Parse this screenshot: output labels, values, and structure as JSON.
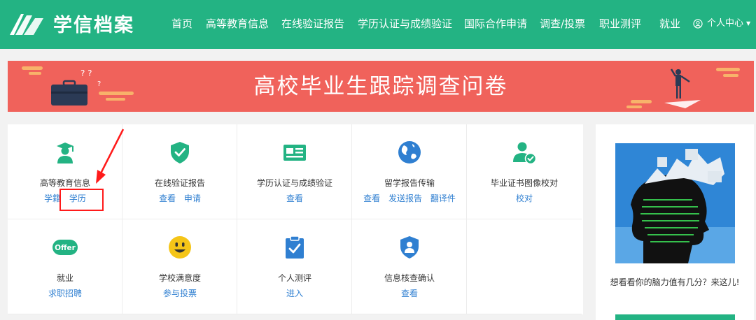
{
  "header": {
    "brand": "学信档案",
    "nav": [
      "首页",
      "高等教育信息",
      "在线验证报告",
      "学历认证与成绩验证",
      "国际合作申请",
      "调查/投票",
      "职业测评",
      "就业"
    ],
    "user_menu": "个人中心",
    "accent_color": "#23b383"
  },
  "banner": {
    "title": "高校毕业生跟踪调查问卷",
    "color": "#f0625b"
  },
  "services": [
    {
      "title": "高等教育信息",
      "icon": "graduate-icon",
      "links": [
        "学籍",
        "学历"
      ]
    },
    {
      "title": "在线验证报告",
      "icon": "shield-check-icon",
      "links": [
        "查看",
        "申请"
      ]
    },
    {
      "title": "学历认证与成绩验证",
      "icon": "id-card-icon",
      "links": [
        "查看"
      ]
    },
    {
      "title": "留学报告传输",
      "icon": "globe-icon",
      "links": [
        "查看",
        "发送报告",
        "翻译件"
      ]
    },
    {
      "title": "毕业证书图像校对",
      "icon": "user-check-icon",
      "links": [
        "校对"
      ]
    },
    {
      "title": "就业",
      "icon": "offer-icon",
      "links": [
        "求职招聘"
      ]
    },
    {
      "title": "学校满意度",
      "icon": "smiley-icon",
      "links": [
        "参与投票"
      ]
    },
    {
      "title": "个人测评",
      "icon": "clipboard-check-icon",
      "links": [
        "进入"
      ]
    },
    {
      "title": "信息核查确认",
      "icon": "user-shield-icon",
      "links": [
        "查看"
      ]
    }
  ],
  "offer_badge": "Offer",
  "side": {
    "text": "想看看你的脑力值有几分？来这儿!"
  }
}
